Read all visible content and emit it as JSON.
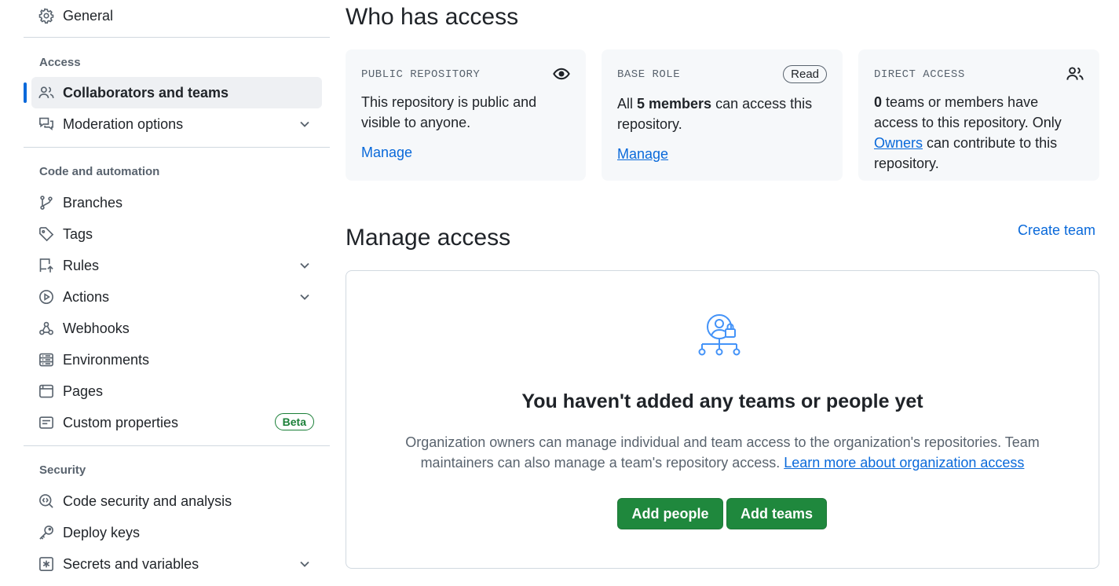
{
  "sidebar": {
    "general": "General",
    "sections": {
      "access": "Access",
      "code_automation": "Code and automation",
      "security": "Security"
    },
    "items": {
      "collaborators": "Collaborators and teams",
      "moderation": "Moderation options",
      "branches": "Branches",
      "tags": "Tags",
      "rules": "Rules",
      "actions": "Actions",
      "webhooks": "Webhooks",
      "environments": "Environments",
      "pages": "Pages",
      "custom_properties": "Custom properties",
      "code_security": "Code security and analysis",
      "deploy_keys": "Deploy keys",
      "secrets": "Secrets and variables"
    },
    "beta_badge": "Beta"
  },
  "who_has_access": {
    "title": "Who has access",
    "public": {
      "label": "PUBLIC REPOSITORY",
      "text": "This repository is public and visible to anyone.",
      "manage": "Manage"
    },
    "base_role": {
      "label": "BASE ROLE",
      "badge": "Read",
      "text_pre": "All ",
      "text_bold": "5 members",
      "text_post": " can access this repository.",
      "manage": "Manage"
    },
    "direct": {
      "label": "DIRECT ACCESS",
      "count": "0",
      "text_1": " teams or members have access to this repository. Only ",
      "owners_link": "Owners",
      "text_2": " can contribute to this repository."
    }
  },
  "manage_access": {
    "title": "Manage access",
    "create_team": "Create team",
    "blank_title": "You haven't added any teams or people yet",
    "blank_desc": "Organization owners can manage individual and team access to the organization's repositories. Team maintainers can also manage a team's repository access.",
    "learn_more": "Learn more about organization access",
    "add_people": "Add people",
    "add_teams": "Add teams"
  },
  "colors": {
    "accent": "#0969da",
    "primary_button": "#1f883d",
    "success": "#1a7f37"
  },
  "icons": [
    "gear-icon",
    "people-icon",
    "comment-discussion-icon",
    "git-branch-icon",
    "tag-icon",
    "rules-icon",
    "play-icon",
    "webhook-icon",
    "server-icon",
    "browser-icon",
    "note-icon",
    "codescan-icon",
    "key-icon",
    "asterisk-icon",
    "chevron-down-icon",
    "eye-icon",
    "person-lock-icon"
  ]
}
